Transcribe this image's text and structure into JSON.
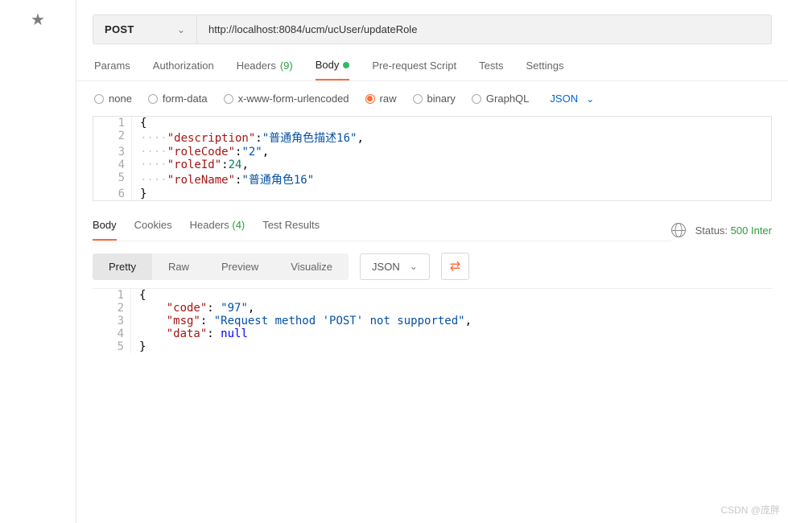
{
  "method": "POST",
  "url": "http://localhost:8084/ucm/ucUser/updateRole",
  "req_tabs": {
    "params": "Params",
    "auth": "Authorization",
    "headers_lbl": "Headers",
    "headers_count": "(9)",
    "body": "Body",
    "pre": "Pre-request Script",
    "tests": "Tests",
    "settings": "Settings"
  },
  "body_opts": {
    "none": "none",
    "form": "form-data",
    "xform": "x-www-form-urlencoded",
    "raw": "raw",
    "binary": "binary",
    "graphql": "GraphQL",
    "fmt": "JSON"
  },
  "req_body_lines": [
    {
      "n": "1",
      "pre": "",
      "txt_raw": "{"
    },
    {
      "n": "2",
      "pre": "····",
      "k": "\"description\"",
      "v": "\"普通角色描述16\"",
      "trail": ","
    },
    {
      "n": "3",
      "pre": "····",
      "k": "\"roleCode\"",
      "v": "\"2\"",
      "trail": ","
    },
    {
      "n": "4",
      "pre": "····",
      "k": "\"roleId\"",
      "num": "24",
      "trail": ","
    },
    {
      "n": "5",
      "pre": "····",
      "k": "\"roleName\"",
      "v": "\"普通角色16\"",
      "trail": ""
    },
    {
      "n": "6",
      "pre": "",
      "txt_raw": "}"
    }
  ],
  "resp_tabs": {
    "body": "Body",
    "cookies": "Cookies",
    "headers_lbl": "Headers",
    "headers_count": "(4)",
    "tests": "Test Results"
  },
  "status": {
    "label": "Status:",
    "value": "500 Inter"
  },
  "view_modes": {
    "pretty": "Pretty",
    "raw": "Raw",
    "preview": "Preview",
    "visualize": "Visualize",
    "fmt": "JSON"
  },
  "resp_body_lines": [
    {
      "n": "1",
      "pre": "",
      "txt_raw": "{"
    },
    {
      "n": "2",
      "pre": "    ",
      "k": "\"code\"",
      "v": "\"97\"",
      "trail": ","
    },
    {
      "n": "3",
      "pre": "    ",
      "k": "\"msg\"",
      "v": "\"Request method 'POST' not supported\"",
      "trail": ","
    },
    {
      "n": "4",
      "pre": "    ",
      "k": "\"data\"",
      "kw": "null",
      "trail": ""
    },
    {
      "n": "5",
      "pre": "",
      "txt_raw": "}"
    }
  ],
  "watermark": "CSDN @庞胖"
}
